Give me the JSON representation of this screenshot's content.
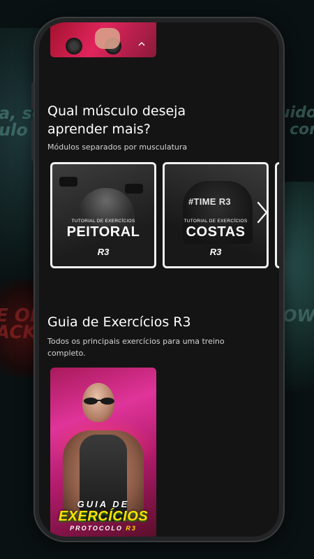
{
  "background": {
    "fragment_left": "a, so\nulo co",
    "fragment_right": "uido\ncor",
    "fragment_red": "E OF\nACK",
    "fragment_teal": "OW"
  },
  "section_modules": {
    "title": "Qual músculo deseja aprender mais?",
    "subtitle": "Módulos separados por musculatura",
    "cards": [
      {
        "small": "TUTORIAL DE EXERCÍCIOS",
        "big": "PEITORAL",
        "logo": "R3"
      },
      {
        "tag": "#TIME R3",
        "small": "TUTORIAL DE EXERCÍCIOS",
        "big": "COSTAS",
        "logo": "R3"
      }
    ]
  },
  "section_guide": {
    "title": "Guia de Exercícios R3",
    "subtitle": "Todos os principais exercícios para uma treino completo.",
    "card": {
      "line1": "GUIA DE",
      "line2": "EXERCÍCIOS",
      "line3": "PROTOCOLO",
      "line3_accent": "R3"
    }
  },
  "icons": {
    "chevron_up": "chevron-up-icon",
    "next": "chevron-right-icon"
  },
  "colors": {
    "screen_bg": "#141414",
    "accent_yellow": "#ffe000",
    "card_border": "#f2f2f2"
  }
}
